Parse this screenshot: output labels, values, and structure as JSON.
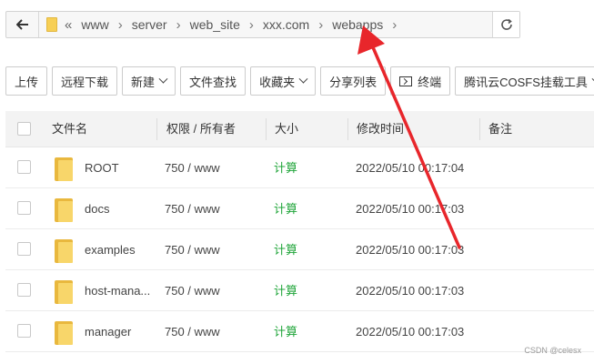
{
  "pathbar": {
    "back_icon": "arrow-left-icon",
    "folder_icon": "folder-icon",
    "overflow": "«",
    "crumbs": [
      "www",
      "server",
      "web_site",
      "xxx.com",
      "webapps"
    ],
    "separator": "›",
    "refresh_icon": "refresh-icon"
  },
  "toolbar": {
    "upload": "上传",
    "remote_download": "远程下载",
    "new": "新建",
    "file_search": "文件查找",
    "favorites": "收藏夹",
    "share_list": "分享列表",
    "terminal": "终端",
    "cosfs": "腾讯云COSFS挂载工具"
  },
  "table": {
    "headers": {
      "name": "文件名",
      "perm": "权限 / 所有者",
      "size": "大小",
      "mtime": "修改时间",
      "note": "备注"
    },
    "rows": [
      {
        "name": "ROOT",
        "perm": "750 / www",
        "size": "计算",
        "mtime": "2022/05/10 00:17:04"
      },
      {
        "name": "docs",
        "perm": "750 / www",
        "size": "计算",
        "mtime": "2022/05/10 00:17:03"
      },
      {
        "name": "examples",
        "perm": "750 / www",
        "size": "计算",
        "mtime": "2022/05/10 00:17:03"
      },
      {
        "name": "host-mana...",
        "perm": "750 / www",
        "size": "计算",
        "mtime": "2022/05/10 00:17:03"
      },
      {
        "name": "manager",
        "perm": "750 / www",
        "size": "计算",
        "mtime": "2022/05/10 00:17:03"
      }
    ]
  },
  "annotation": {
    "color": "#e8262b"
  },
  "watermark": "CSDN @celesx"
}
